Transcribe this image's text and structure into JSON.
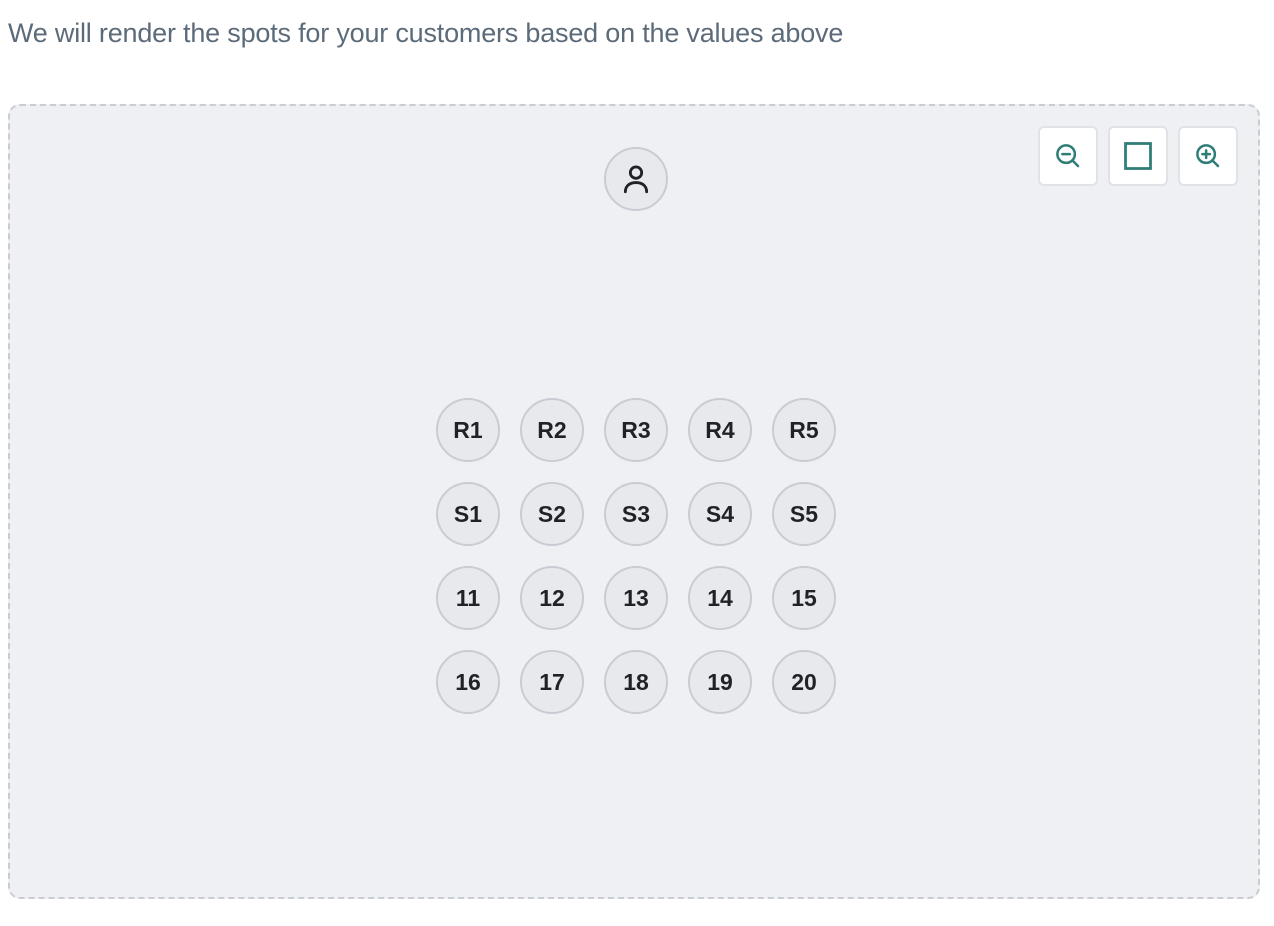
{
  "description": "We will render the spots for your customers based on the values above",
  "zoom_controls": [
    {
      "name": "zoom-out-button",
      "icon": "zoom-out-icon"
    },
    {
      "name": "fit-view-button",
      "icon": "square-icon"
    },
    {
      "name": "zoom-in-button",
      "icon": "zoom-in-icon"
    }
  ],
  "instructor": {
    "icon": "person-icon"
  },
  "spots": [
    [
      "R1",
      "R2",
      "R3",
      "R4",
      "R5"
    ],
    [
      "S1",
      "S2",
      "S3",
      "S4",
      "S5"
    ],
    [
      "11",
      "12",
      "13",
      "14",
      "15"
    ],
    [
      "16",
      "17",
      "18",
      "19",
      "20"
    ]
  ],
  "colors": {
    "accent": "#2e7d77",
    "canvas_bg": "#eff0f4",
    "spot_bg": "#e7e9ed",
    "spot_border": "#c8ccd3",
    "text_muted": "#5c6b7a"
  }
}
